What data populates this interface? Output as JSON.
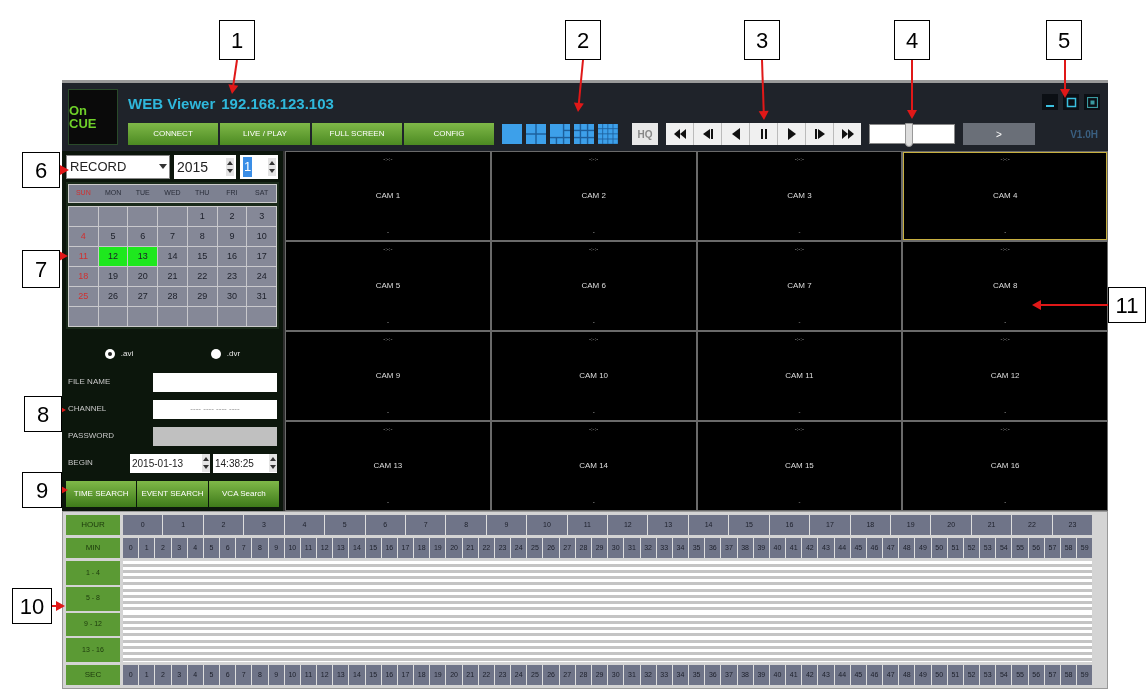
{
  "callouts": [
    {
      "label": "1"
    },
    {
      "label": "2"
    },
    {
      "label": "3"
    },
    {
      "label": "4"
    },
    {
      "label": "5"
    },
    {
      "label": "6"
    },
    {
      "label": "7"
    },
    {
      "label": "8"
    },
    {
      "label": "9"
    },
    {
      "label": "10"
    },
    {
      "label": "11"
    }
  ],
  "header": {
    "logo": "On CUE",
    "title": "WEB Viewer",
    "address": "192.168.123.103",
    "version": "V1.0H",
    "window_controls": [
      {
        "kind": "minimize"
      },
      {
        "kind": "maximize"
      },
      {
        "kind": "exit"
      }
    ],
    "nav_buttons": [
      "CONNECT",
      "LIVE / PLAY",
      "FULL SCREEN",
      "CONFIG"
    ],
    "layouts": [
      {
        "kind": "single"
      },
      {
        "kind": "quad"
      },
      {
        "kind": "six"
      },
      {
        "kind": "nine"
      },
      {
        "kind": "sixteen"
      }
    ],
    "quality_button": "HQ",
    "playback": [
      {
        "kind": "rewind"
      },
      {
        "kind": "step-back"
      },
      {
        "kind": "reverse"
      },
      {
        "kind": "pause"
      },
      {
        "kind": "play"
      },
      {
        "kind": "step-forward"
      },
      {
        "kind": "fast-forward"
      }
    ],
    "speed": {
      "level": 0.47
    },
    "go_button": ">"
  },
  "search": {
    "mode": "RECORD",
    "year": "2015",
    "month": {
      "value": "1",
      "highlighted": true
    },
    "weekdays": [
      "SUN",
      "MON",
      "TUE",
      "WED",
      "THU",
      "FRI",
      "SAT"
    ],
    "weeks": [
      [
        {
          "kind": "blank"
        },
        {
          "kind": "blank"
        },
        {
          "kind": "blank"
        },
        {
          "kind": "blank"
        },
        {
          "day": "1",
          "recorded": false
        },
        {
          "day": "2",
          "recorded": false
        },
        {
          "day": "3",
          "recorded": false
        }
      ],
      [
        {
          "day": "4",
          "recorded": false
        },
        {
          "day": "5",
          "recorded": false
        },
        {
          "day": "6",
          "recorded": false
        },
        {
          "day": "7",
          "recorded": false
        },
        {
          "day": "8",
          "recorded": false
        },
        {
          "day": "9",
          "recorded": false
        },
        {
          "day": "10",
          "recorded": false
        }
      ],
      [
        {
          "day": "11",
          "recorded": false
        },
        {
          "day": "12",
          "recorded": true
        },
        {
          "day": "13",
          "recorded": true
        },
        {
          "day": "14",
          "recorded": false
        },
        {
          "day": "15",
          "recorded": false
        },
        {
          "day": "16",
          "recorded": false
        },
        {
          "day": "17",
          "recorded": false
        }
      ],
      [
        {
          "day": "18",
          "recorded": false
        },
        {
          "day": "19",
          "recorded": false
        },
        {
          "day": "20",
          "recorded": false
        },
        {
          "day": "21",
          "recorded": false
        },
        {
          "day": "22",
          "recorded": false
        },
        {
          "day": "23",
          "recorded": false
        },
        {
          "day": "24",
          "recorded": false
        }
      ],
      [
        {
          "day": "25",
          "recorded": false
        },
        {
          "day": "26",
          "recorded": false
        },
        {
          "day": "27",
          "recorded": false
        },
        {
          "day": "28",
          "recorded": false
        },
        {
          "day": "29",
          "recorded": false
        },
        {
          "day": "30",
          "recorded": false
        },
        {
          "day": "31",
          "recorded": false
        }
      ]
    ],
    "formats": [
      {
        "label": ".avi",
        "selected": true
      },
      {
        "label": ".dvr",
        "selected": false
      }
    ],
    "fields": [
      {
        "label": "FILE NAME",
        "disabled": false
      },
      {
        "label": "CHANNEL",
        "value": "---- ---- ---- ----",
        "disabled": false
      },
      {
        "label": "PASSWORD",
        "disabled": true
      }
    ],
    "begin": {
      "label": "BEGIN",
      "date": "2015-01-13",
      "time": "14:38:25"
    },
    "buttons": [
      "TIME SEARCH",
      "EVENT SEARCH",
      "VCA Search"
    ]
  },
  "cameras": [
    {
      "name": "CAM 1",
      "time": "-:-:-",
      "status": "-",
      "selected": false
    },
    {
      "name": "CAM 2",
      "time": "-:-:-",
      "status": "-",
      "selected": false
    },
    {
      "name": "CAM 3",
      "time": "-:-:-",
      "status": "-",
      "selected": false
    },
    {
      "name": "CAM 4",
      "time": "-:-:-",
      "status": "-",
      "selected": true
    },
    {
      "name": "CAM 5",
      "time": "-:-:-",
      "status": "-",
      "selected": false
    },
    {
      "name": "CAM 6",
      "time": "-:-:-",
      "status": "-",
      "selected": false
    },
    {
      "name": "CAM 7",
      "time": "-:-:-",
      "status": "-",
      "selected": false
    },
    {
      "name": "CAM 8",
      "time": "-:-:-",
      "status": "-",
      "selected": false
    },
    {
      "name": "CAM 9",
      "time": "-:-:-",
      "status": "-",
      "selected": false
    },
    {
      "name": "CAM 10",
      "time": "-:-:-",
      "status": "-",
      "selected": false
    },
    {
      "name": "CAM 11",
      "time": "-:-:-",
      "status": "-",
      "selected": false
    },
    {
      "name": "CAM 12",
      "time": "-:-:-",
      "status": "-",
      "selected": false
    },
    {
      "name": "CAM 13",
      "time": "-:-:-",
      "status": "-",
      "selected": false
    },
    {
      "name": "CAM 14",
      "time": "-:-:-",
      "status": "-",
      "selected": false
    },
    {
      "name": "CAM 15",
      "time": "-:-:-",
      "status": "-",
      "selected": false
    },
    {
      "name": "CAM 16",
      "time": "-:-:-",
      "status": "-",
      "selected": false
    }
  ],
  "timeline": {
    "hour_label": "HOUR",
    "min_label": "MIN",
    "sec_label": "SEC",
    "hours": [
      "0",
      "1",
      "2",
      "3",
      "4",
      "5",
      "6",
      "7",
      "8",
      "9",
      "10",
      "11",
      "12",
      "13",
      "14",
      "15",
      "16",
      "17",
      "18",
      "19",
      "20",
      "21",
      "22",
      "23"
    ],
    "minutes": [
      "0",
      "1",
      "2",
      "3",
      "4",
      "5",
      "6",
      "7",
      "8",
      "9",
      "10",
      "11",
      "12",
      "13",
      "14",
      "15",
      "16",
      "17",
      "18",
      "19",
      "20",
      "21",
      "22",
      "23",
      "24",
      "25",
      "26",
      "27",
      "28",
      "29",
      "30",
      "31",
      "32",
      "33",
      "34",
      "35",
      "36",
      "37",
      "38",
      "39",
      "40",
      "41",
      "42",
      "43",
      "44",
      "45",
      "46",
      "47",
      "48",
      "49",
      "50",
      "51",
      "52",
      "53",
      "54",
      "55",
      "56",
      "57",
      "58",
      "59"
    ],
    "channel_groups": [
      "1 - 4",
      "5 - 8",
      "9 - 12",
      "13 - 16"
    ],
    "seconds": [
      "0",
      "1",
      "2",
      "3",
      "4",
      "5",
      "6",
      "7",
      "8",
      "9",
      "10",
      "11",
      "12",
      "13",
      "14",
      "15",
      "16",
      "17",
      "18",
      "19",
      "20",
      "21",
      "22",
      "23",
      "24",
      "25",
      "26",
      "27",
      "28",
      "29",
      "30",
      "31",
      "32",
      "33",
      "34",
      "35",
      "36",
      "37",
      "38",
      "39",
      "40",
      "41",
      "42",
      "43",
      "44",
      "45",
      "46",
      "47",
      "48",
      "49",
      "50",
      "51",
      "52",
      "53",
      "54",
      "55",
      "56",
      "57",
      "58",
      "59"
    ]
  }
}
